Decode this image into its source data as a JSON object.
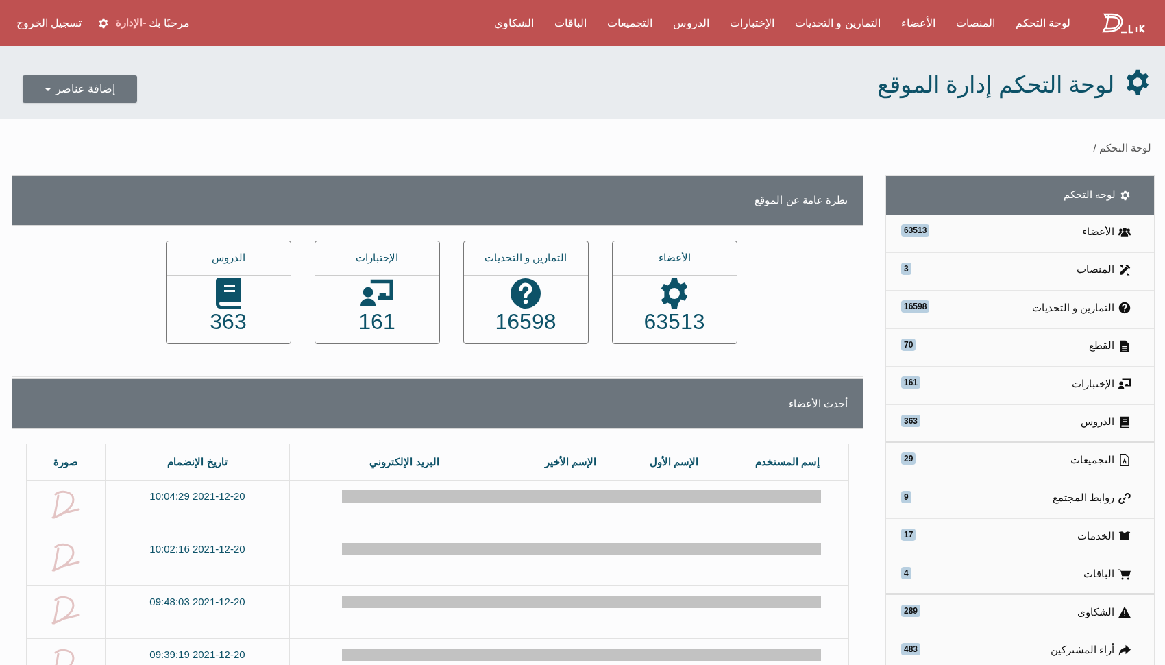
{
  "navbar": {
    "links": [
      "لوحة التحكم",
      "المنصات",
      "الأعضاء",
      "التمارين و التحديات",
      "الإختبارات",
      "الدروس",
      "التجميعات",
      "الباقات",
      "الشكاوي"
    ],
    "welcome": "مرحبًا بك",
    "role": "-الإدارة",
    "logout": "تسجيل الخروج"
  },
  "header": {
    "title": "لوحة التحكم إدارة الموقع",
    "add_button": "إضافة عناصر"
  },
  "breadcrumb": "لوحة التحكم /",
  "overview": {
    "title": "نظرة عامة عن الموقع",
    "cards": [
      {
        "label": "الأعضاء",
        "value": "63513"
      },
      {
        "label": "التمارين و التحديات",
        "value": "16598"
      },
      {
        "label": "الإختبارات",
        "value": "161"
      },
      {
        "label": "الدروس",
        "value": "363"
      }
    ]
  },
  "latest_members": {
    "title": "أحدث الأعضاء",
    "columns": [
      "إسم المستخدم",
      "الإسم الأول",
      "الإسم الأخير",
      "البريد الإلكتروني",
      "تاريخ الإنضمام",
      "صورة"
    ],
    "rows": [
      {
        "joined": "10:04:29 2021-12-20",
        "redacted": true
      },
      {
        "joined": "10:02:16 2021-12-20",
        "redacted": true
      },
      {
        "joined": "09:48:03 2021-12-20",
        "redacted": true
      },
      {
        "joined": "09:39:19 2021-12-20",
        "redacted": true
      }
    ]
  },
  "sidebar": {
    "title": "لوحة التحكم",
    "items": [
      {
        "label": "الأعضاء",
        "count": "63513"
      },
      {
        "label": "المنصات",
        "count": "3"
      },
      {
        "label": "التمارين و التحديات",
        "count": "16598"
      },
      {
        "label": "القطع",
        "count": "70"
      },
      {
        "label": "الإختبارات",
        "count": "161"
      },
      {
        "label": "الدروس",
        "count": "363"
      },
      {
        "label": "التجميعات",
        "count": "29"
      },
      {
        "label": "روابط المجتمع",
        "count": "9"
      },
      {
        "label": "الخدمات",
        "count": "17"
      },
      {
        "label": "الباقات",
        "count": "4"
      },
      {
        "label": "الشكاوي",
        "count": "289"
      },
      {
        "label": "أراء المشتركين",
        "count": "483"
      }
    ]
  }
}
